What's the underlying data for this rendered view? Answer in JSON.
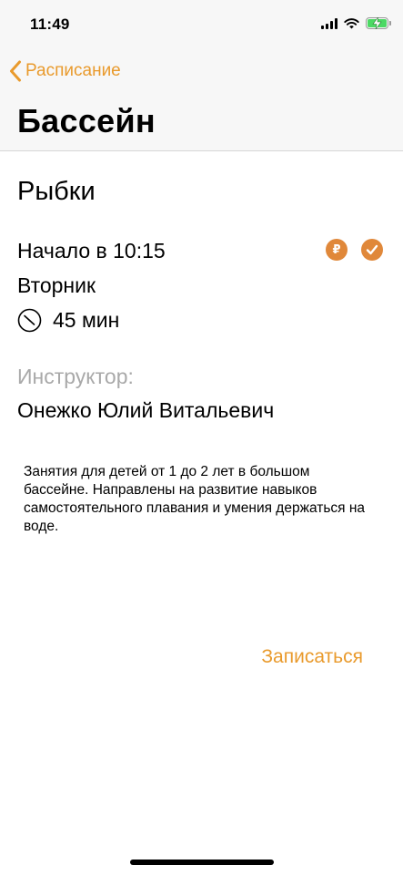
{
  "status_bar": {
    "time": "11:49",
    "icons": [
      "cellular-signal-icon",
      "wifi-icon",
      "battery-charging-icon"
    ],
    "battery_color": "#4cd964"
  },
  "navigation": {
    "back_label": "Расписание",
    "back_icon": "chevron-left-icon",
    "title": "Бассейн",
    "accent_color": "#e99a2c"
  },
  "class": {
    "name": "Рыбки",
    "start": "Начало в 10:15",
    "day": "Вторник",
    "duration": "45 мин",
    "duration_icon": "clock-icon",
    "badges": [
      {
        "icon": "ruble-icon",
        "text": "₽"
      },
      {
        "icon": "checkmark-icon"
      }
    ],
    "badge_color": "#e0883a"
  },
  "instructor": {
    "label": "Инструктор:",
    "name": "Онежко Юлий Витальевич"
  },
  "description": "Занятия для детей от 1 до 2 лет в большом бассейне. Направлены на развитие навыков самостоятельного плавания и умения держаться на воде.",
  "actions": {
    "enroll_label": "Записаться"
  }
}
